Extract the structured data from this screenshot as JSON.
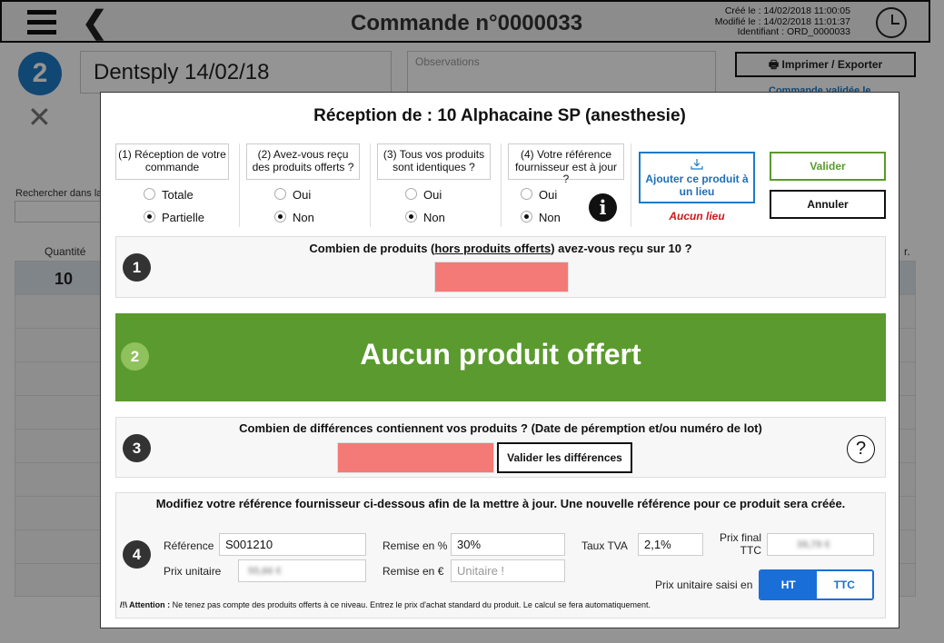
{
  "header": {
    "title": "Commande n°0000033",
    "created": "Créé le : 14/02/2018 11:00:05",
    "modified": "Modifié le : 14/02/2018 11:01:37",
    "identifier": "Identifiant : ORD_0000033"
  },
  "background": {
    "step_number": "2",
    "supplier": "Dentsply 14/02/18",
    "observations_placeholder": "Observations",
    "print_label": "Imprimer / Exporter",
    "validated_label": "Commande validée le",
    "search_label": "Rechercher dans la",
    "quantity_header": "Quantité",
    "quantity_value": "10",
    "truncated_header": "r."
  },
  "modal": {
    "title": "Réception de : 10 Alphacaine SP (anesthesie)",
    "questions": [
      {
        "label": "(1) Réception de votre commande",
        "options": [
          "Totale",
          "Partielle"
        ],
        "selected": 1
      },
      {
        "label": "(2) Avez-vous reçu des produits offerts ?",
        "options": [
          "Oui",
          "Non"
        ],
        "selected": 1
      },
      {
        "label": "(3) Tous vos produits sont identiques ?",
        "options": [
          "Oui",
          "Non"
        ],
        "selected": 1
      },
      {
        "label": "(4) Votre référence fournisseur est à jour ?",
        "options": [
          "Oui",
          "Non"
        ],
        "selected": 1
      }
    ],
    "place_button": "Ajouter ce produit à un lieu",
    "no_place": "Aucun lieu",
    "validate_button": "Valider",
    "cancel_button": "Annuler",
    "section1": {
      "number": "1",
      "question_pre": "Combien de produits (",
      "question_link": "hors produits offerts",
      "question_post": ") avez-vous reçu sur 10 ?"
    },
    "section2": {
      "number": "2",
      "text": "Aucun produit offert"
    },
    "section3": {
      "number": "3",
      "question": "Combien de différences contiennent vos produits ? (Date de péremption et/ou numéro de lot)",
      "button": "Valider les différences"
    },
    "section4": {
      "number": "4",
      "heading": "Modifiez votre référence fournisseur ci-dessous afin de la mettre à jour. Une nouvelle référence pour ce produit sera créée.",
      "reference_label": "Référence",
      "reference_value": "S001210",
      "unit_price_label": "Prix unitaire",
      "unit_price_blurred": "55,66 €",
      "discount_pct_label": "Remise en %",
      "discount_pct_value": "30%",
      "discount_eur_label": "Remise en €",
      "discount_eur_placeholder": "Unitaire !",
      "vat_label": "Taux TVA",
      "vat_value": "2,1%",
      "final_price_label_1": "Prix final",
      "final_price_label_2": "TTC",
      "final_price_blurred": "39,79 €",
      "price_entered_label": "Prix unitaire saisi en",
      "toggle_ht": "HT",
      "toggle_ttc": "TTC",
      "attention_bold": "/!\\ Attention :",
      "attention_text": " Ne tenez pas compte des produits offerts à ce niveau. Entrez le prix d'achat standard du produit. Le calcul se fera automatiquement."
    }
  },
  "colors": {
    "accent_blue": "#1e7bc6",
    "toggle_blue": "#1a6ed8",
    "green": "#5a9a2e",
    "red_input": "#f47a78",
    "error_red": "#d01818"
  }
}
